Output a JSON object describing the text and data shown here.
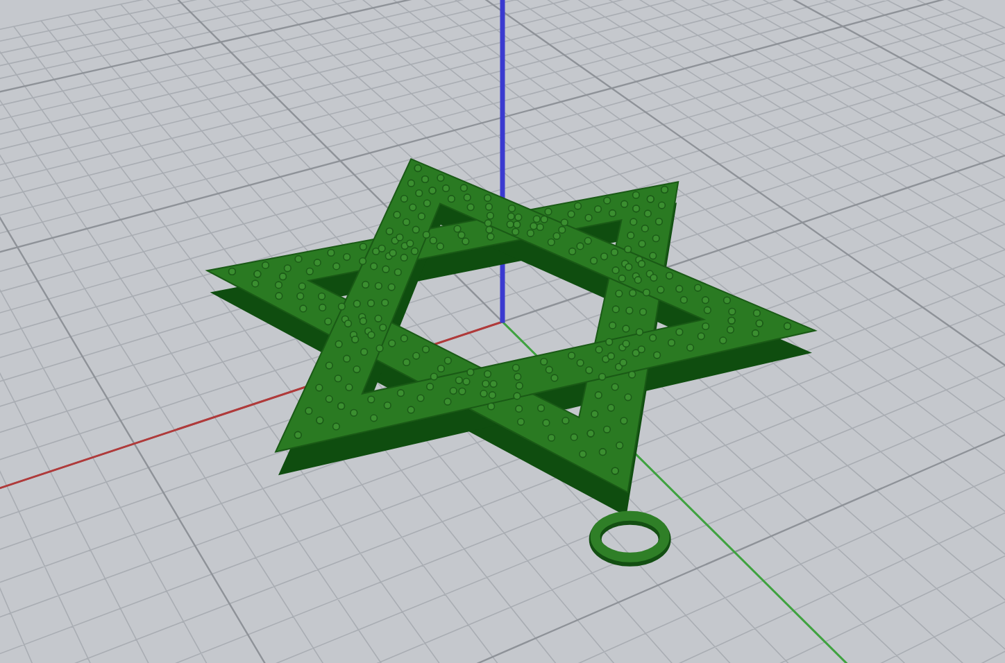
{
  "viewport": {
    "axes": [
      {
        "kind": "x",
        "color": "#b03a3a"
      },
      {
        "kind": "y",
        "color": "#3fa33f"
      },
      {
        "kind": "z",
        "color": "#3b3bd0"
      }
    ]
  }
}
